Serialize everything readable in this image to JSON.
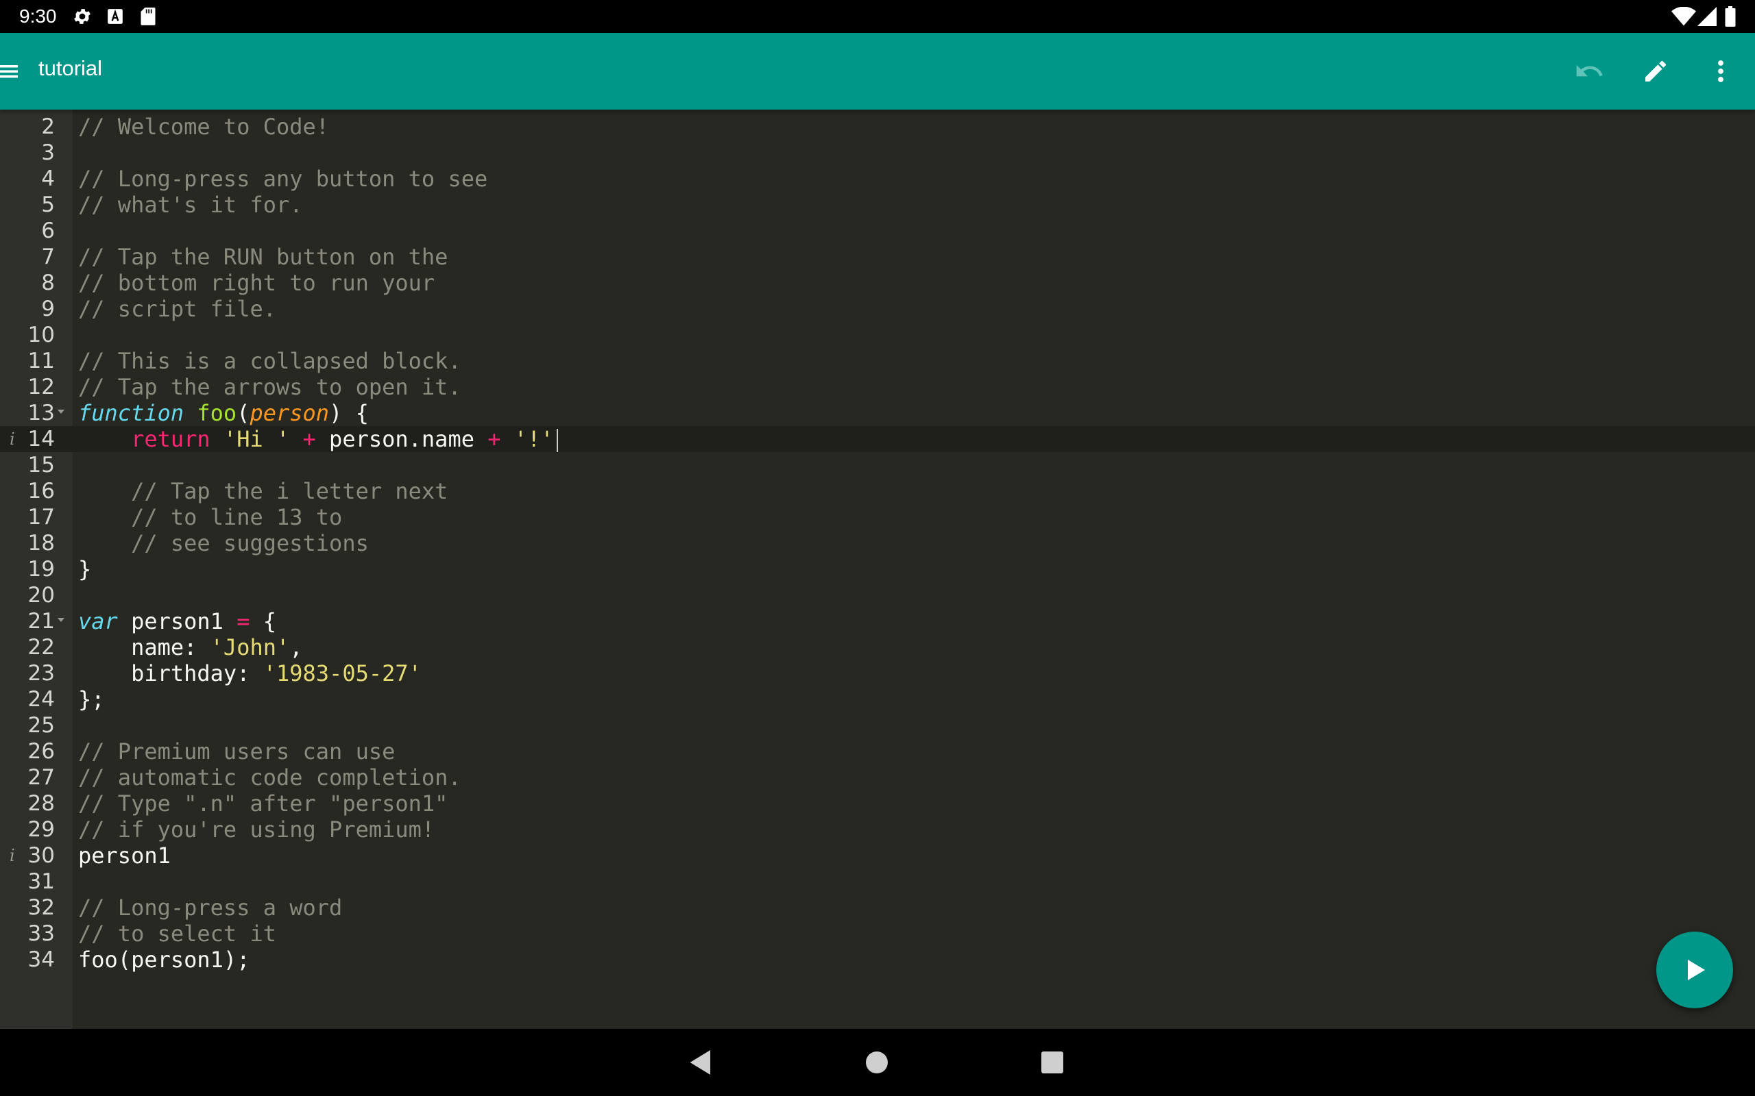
{
  "status_bar": {
    "time": "9:30",
    "left_icons": [
      "gear-icon",
      "text-a-icon",
      "sd-card-icon"
    ],
    "right_icons": [
      "wifi-icon",
      "cell-signal-icon",
      "battery-icon"
    ]
  },
  "app_bar": {
    "title": "tutorial",
    "menu_icon": "hamburger-menu-icon",
    "actions": [
      "undo-icon",
      "edit-pencil-icon",
      "more-vert-icon"
    ]
  },
  "editor": {
    "active_line": 14,
    "lines": [
      {
        "n": "2",
        "text": "// Welcome to Code!"
      },
      {
        "n": "3",
        "text": ""
      },
      {
        "n": "4",
        "text": "// Long-press any button to see"
      },
      {
        "n": "5",
        "text": "// what's it for."
      },
      {
        "n": "6",
        "text": ""
      },
      {
        "n": "7",
        "text": "// Tap the RUN button on the"
      },
      {
        "n": "8",
        "text": "// bottom right to run your"
      },
      {
        "n": "9",
        "text": "// script file."
      },
      {
        "n": "10",
        "text": ""
      },
      {
        "n": "11",
        "text": "// This is a collapsed block."
      },
      {
        "n": "12",
        "text": "// Tap the arrows to open it."
      },
      {
        "n": "13",
        "text": "function foo(person) {",
        "fold": true
      },
      {
        "n": "14",
        "text": "    return 'Hi ' + person.name + '!'",
        "info": true
      },
      {
        "n": "15",
        "text": ""
      },
      {
        "n": "16",
        "text": "    // Tap the i letter next"
      },
      {
        "n": "17",
        "text": "    // to line 13 to"
      },
      {
        "n": "18",
        "text": "    // see suggestions"
      },
      {
        "n": "19",
        "text": "}"
      },
      {
        "n": "20",
        "text": ""
      },
      {
        "n": "21",
        "text": "var person1 = {",
        "fold": true
      },
      {
        "n": "22",
        "text": "    name: 'John',"
      },
      {
        "n": "23",
        "text": "    birthday: '1983-05-27'"
      },
      {
        "n": "24",
        "text": "};"
      },
      {
        "n": "25",
        "text": ""
      },
      {
        "n": "26",
        "text": "// Premium users can use"
      },
      {
        "n": "27",
        "text": "// automatic code completion."
      },
      {
        "n": "28",
        "text": "// Type \".n\" after \"person1\""
      },
      {
        "n": "29",
        "text": "// if you're using Premium!"
      },
      {
        "n": "30",
        "text": "person1",
        "info": true
      },
      {
        "n": "31",
        "text": ""
      },
      {
        "n": "32",
        "text": "// Long-press a word"
      },
      {
        "n": "33",
        "text": "// to select it"
      },
      {
        "n": "34",
        "text": "foo(person1);"
      }
    ]
  },
  "fab": {
    "icon": "play-icon"
  },
  "nav_bar": {
    "buttons": [
      "back-icon",
      "home-icon",
      "recents-icon"
    ]
  },
  "colors": {
    "accent": "#009688",
    "editor_bg": "#272822",
    "comment": "#8a8a7e",
    "keyword": "#66d9ef",
    "function": "#a6e22e",
    "param": "#fd971f",
    "string": "#e6db74",
    "operator": "#f92672"
  }
}
